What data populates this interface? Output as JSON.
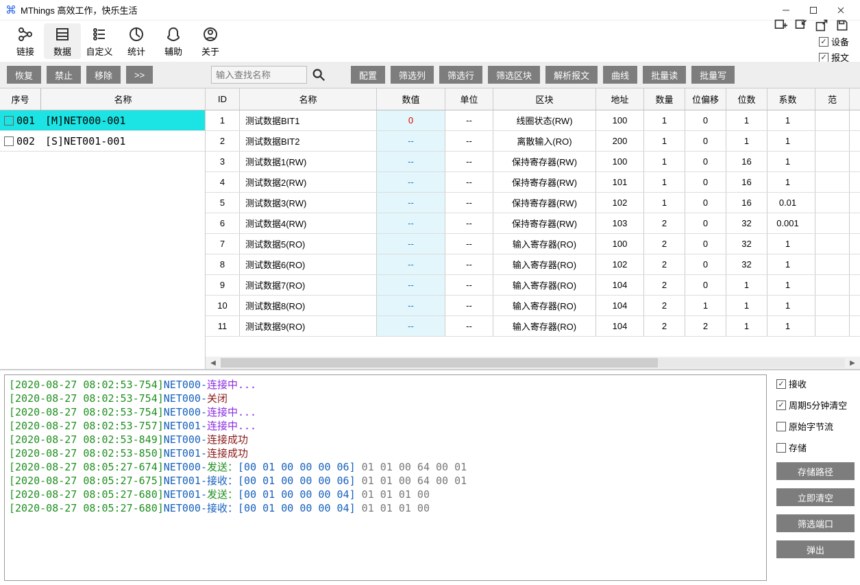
{
  "window": {
    "title": "MThings  高效工作，快乐生活"
  },
  "maintabs": [
    {
      "icon": "link",
      "label": "链接"
    },
    {
      "icon": "data",
      "label": "数据",
      "active": true
    },
    {
      "icon": "custom",
      "label": "自定义"
    },
    {
      "icon": "stats",
      "label": "统计"
    },
    {
      "icon": "assist",
      "label": "辅助"
    },
    {
      "icon": "about",
      "label": "关于"
    }
  ],
  "topchecks": {
    "device": "设备",
    "packet": "报文",
    "device_checked": true,
    "packet_checked": true
  },
  "leftbtns": {
    "recover": "恢复",
    "forbid": "禁止",
    "remove": "移除",
    "more": ">>"
  },
  "search": {
    "placeholder": "输入查找名称"
  },
  "rightbtns": {
    "config": "配置",
    "filtercol": "筛选列",
    "filterrow": "筛选行",
    "filterblock": "筛选区块",
    "parse": "解析报文",
    "curve": "曲线",
    "batchread": "批量读",
    "batchwrite": "批量写"
  },
  "leftcols": {
    "seq": "序号",
    "name": "名称"
  },
  "leftrows": [
    {
      "seq": "001",
      "name": "[M]NET000-001",
      "sel": true
    },
    {
      "seq": "002",
      "name": "[S]NET001-001",
      "sel": false
    }
  ],
  "cols": {
    "id": "ID",
    "name": "名称",
    "val": "数值",
    "unit": "单位",
    "block": "区块",
    "addr": "地址",
    "qty": "数量",
    "bitoff": "位偏移",
    "bits": "位数",
    "coef": "系数",
    "extra": "范"
  },
  "rows": [
    {
      "id": "1",
      "name": "测试数据BIT1",
      "val": "0",
      "valcls": "red",
      "unit": "--",
      "block": "线圈状态(RW)",
      "addr": "100",
      "qty": "1",
      "bitoff": "0",
      "bits": "1",
      "coef": "1"
    },
    {
      "id": "2",
      "name": "测试数据BIT2",
      "val": "--",
      "valcls": "blue",
      "unit": "--",
      "block": "离散输入(RO)",
      "addr": "200",
      "qty": "1",
      "bitoff": "0",
      "bits": "1",
      "coef": "1"
    },
    {
      "id": "3",
      "name": "测试数据1(RW)",
      "val": "--",
      "valcls": "blue",
      "unit": "--",
      "block": "保持寄存器(RW)",
      "addr": "100",
      "qty": "1",
      "bitoff": "0",
      "bits": "16",
      "coef": "1"
    },
    {
      "id": "4",
      "name": "测试数据2(RW)",
      "val": "--",
      "valcls": "blue",
      "unit": "--",
      "block": "保持寄存器(RW)",
      "addr": "101",
      "qty": "1",
      "bitoff": "0",
      "bits": "16",
      "coef": "1"
    },
    {
      "id": "5",
      "name": "测试数据3(RW)",
      "val": "--",
      "valcls": "blue",
      "unit": "--",
      "block": "保持寄存器(RW)",
      "addr": "102",
      "qty": "1",
      "bitoff": "0",
      "bits": "16",
      "coef": "0.01"
    },
    {
      "id": "6",
      "name": "测试数据4(RW)",
      "val": "--",
      "valcls": "blue",
      "unit": "--",
      "block": "保持寄存器(RW)",
      "addr": "103",
      "qty": "2",
      "bitoff": "0",
      "bits": "32",
      "coef": "0.001"
    },
    {
      "id": "7",
      "name": "测试数据5(RO)",
      "val": "--",
      "valcls": "blue",
      "unit": "--",
      "block": "输入寄存器(RO)",
      "addr": "100",
      "qty": "2",
      "bitoff": "0",
      "bits": "32",
      "coef": "1"
    },
    {
      "id": "8",
      "name": "测试数据6(RO)",
      "val": "--",
      "valcls": "blue",
      "unit": "--",
      "block": "输入寄存器(RO)",
      "addr": "102",
      "qty": "2",
      "bitoff": "0",
      "bits": "32",
      "coef": "1"
    },
    {
      "id": "9",
      "name": "测试数据7(RO)",
      "val": "--",
      "valcls": "blue",
      "unit": "--",
      "block": "输入寄存器(RO)",
      "addr": "104",
      "qty": "2",
      "bitoff": "0",
      "bits": "1",
      "coef": "1"
    },
    {
      "id": "10",
      "name": "测试数据8(RO)",
      "val": "--",
      "valcls": "blue",
      "unit": "--",
      "block": "输入寄存器(RO)",
      "addr": "104",
      "qty": "2",
      "bitoff": "1",
      "bits": "1",
      "coef": "1"
    },
    {
      "id": "11",
      "name": "测试数据9(RO)",
      "val": "--",
      "valcls": "blue",
      "unit": "--",
      "block": "输入寄存器(RO)",
      "addr": "104",
      "qty": "2",
      "bitoff": "2",
      "bits": "1",
      "coef": "1"
    }
  ],
  "console": [
    {
      "ts": "[2020-08-27 08:02:53-754]",
      "net": "NET000-",
      "msg": "连接中...",
      "cls": "purple"
    },
    {
      "ts": "[2020-08-27 08:02:53-754]",
      "net": "NET000-",
      "msg": "关闭",
      "cls": "darkred"
    },
    {
      "ts": "[2020-08-27 08:02:53-754]",
      "net": "NET000-",
      "msg": "连接中...",
      "cls": "purple"
    },
    {
      "ts": "[2020-08-27 08:02:53-757]",
      "net": "NET001-",
      "msg": "连接中...",
      "cls": "purple"
    },
    {
      "ts": "[2020-08-27 08:02:53-849]",
      "net": "NET000-",
      "msg": "连接成功",
      "cls": "darkred"
    },
    {
      "ts": "[2020-08-27 08:02:53-850]",
      "net": "NET001-",
      "msg": "连接成功",
      "cls": "darkred"
    },
    {
      "ts": "[2020-08-27 08:05:27-674]",
      "net": "NET000-",
      "act": "发送：",
      "hex": "[00 01 00 00 00 06]",
      "tail": " 01 01 00 64 00 01",
      "actcls": "green"
    },
    {
      "ts": "[2020-08-27 08:05:27-675]",
      "net": "NET001-",
      "act": "接收：",
      "hex": "[00 01 00 00 00 06]",
      "tail": " 01 01 00 64 00 01",
      "actcls": "blue2"
    },
    {
      "ts": "[2020-08-27 08:05:27-680]",
      "net": "NET001-",
      "act": "发送：",
      "hex": "[00 01 00 00 00 04]",
      "tail": " 01 01 01 00",
      "actcls": "green"
    },
    {
      "ts": "[2020-08-27 08:05:27-680]",
      "net": "NET000-",
      "act": "接收：",
      "hex": "[00 01 00 00 00 04]",
      "tail": " 01 01 01 00",
      "actcls": "blue2"
    }
  ],
  "conschecks": {
    "recv": "接收",
    "period": "周期5分钟清空",
    "rawbytes": "原始字节流",
    "store": "存储"
  },
  "consbtns": {
    "storepath": "存储路径",
    "clear": "立即清空",
    "filterport": "筛选端口",
    "popout": "弹出"
  }
}
